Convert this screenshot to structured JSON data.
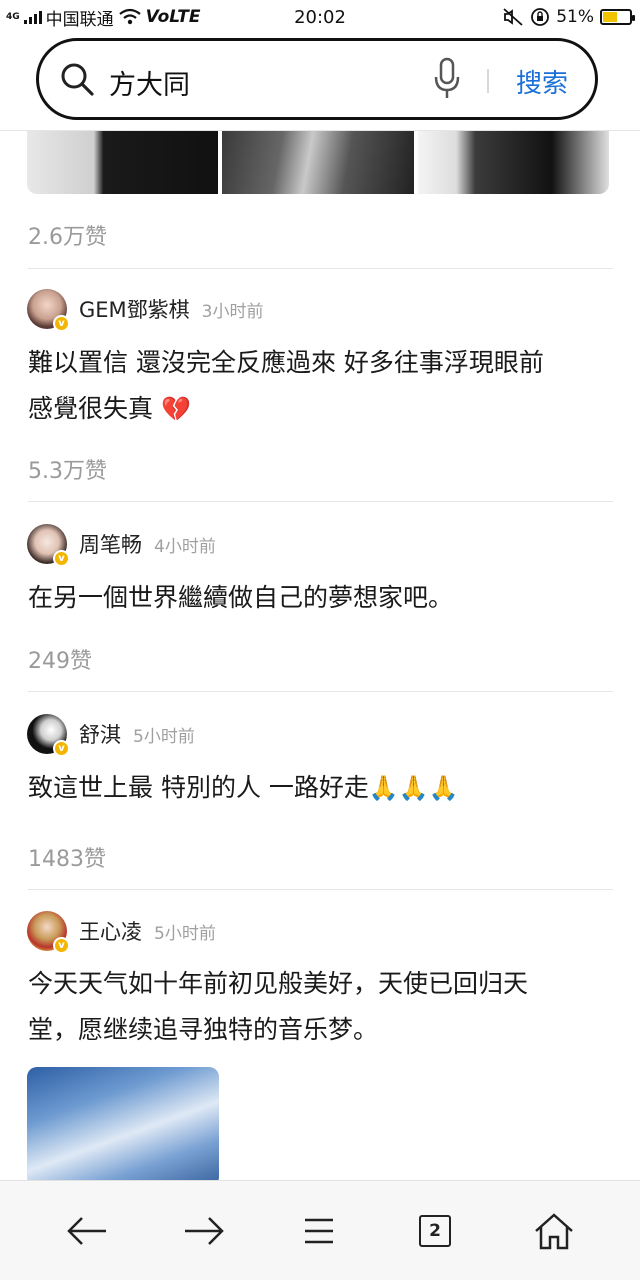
{
  "status_bar": {
    "network": "4G",
    "carrier": "中国联通",
    "volte": "VoLTE",
    "time": "20:02",
    "battery_percent": "51%",
    "battery_level": 0.51
  },
  "search": {
    "query": "方大同",
    "button_label": "搜索"
  },
  "feed": {
    "top_post_likes": "2.6万赞",
    "comments": [
      {
        "author": "GEM鄧紫棋",
        "time": "3小时前",
        "text_lines": [
          "難以置信 還沒完全反應過來 好多往事浮現眼前",
          "感覺很失真"
        ],
        "emoji": "💔",
        "likes": "5.3万赞"
      },
      {
        "author": "周笔畅",
        "time": "4小时前",
        "text_lines": [
          "在另一個世界繼續做自己的夢想家吧。"
        ],
        "likes": "249赞"
      },
      {
        "author": "舒淇",
        "time": "5小时前",
        "text_lines": [
          "致這世上最 特別的人 一路好走"
        ],
        "emoji": "🙏🙏🙏",
        "likes": "1483赞"
      },
      {
        "author": "王心凌",
        "time": "5小时前",
        "text_lines": [
          "今天天气如十年前初见般美好，天使已回归天",
          "堂，愿继续追寻独特的音乐梦。"
        ]
      }
    ]
  },
  "bottom_nav": {
    "back": "back-arrow-icon",
    "forward": "forward-arrow-icon",
    "menu": "menu-icon",
    "tab_count": "2",
    "home": "home-icon"
  },
  "colors": {
    "accent": "#1a6fd8",
    "verified_badge": "#f3b500",
    "meta_text": "#9a9a9a"
  }
}
